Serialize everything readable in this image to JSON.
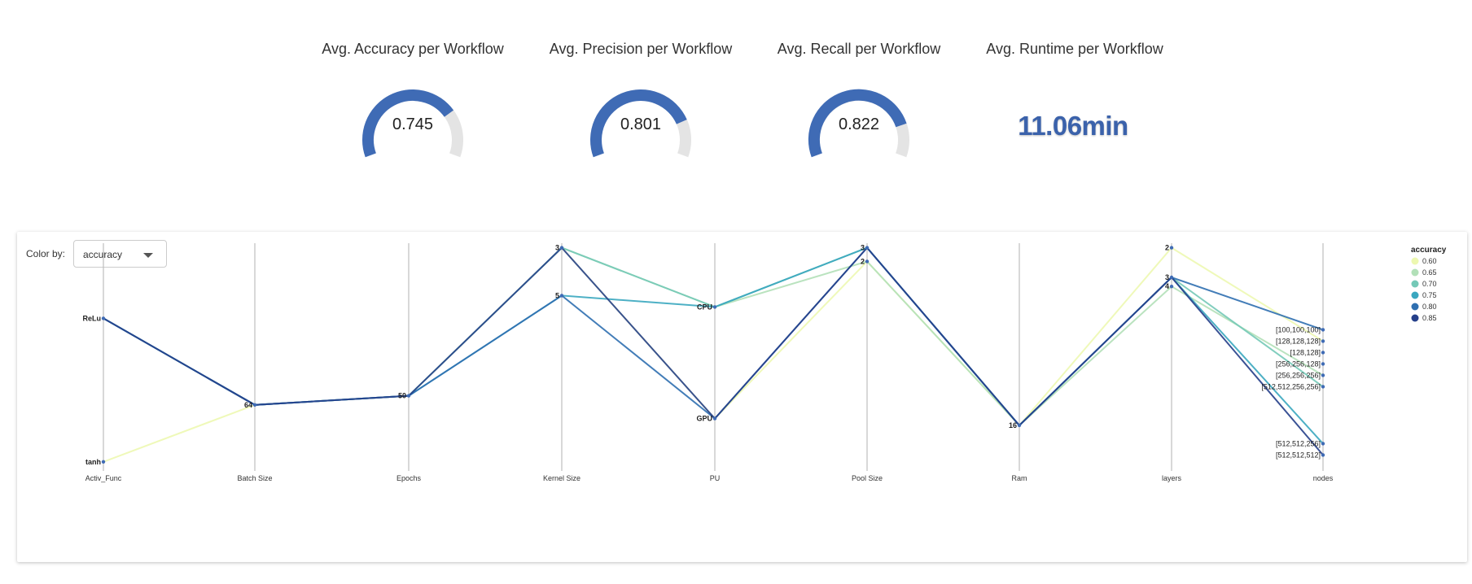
{
  "kpis": {
    "accuracy": {
      "title": "Avg. Accuracy per Workflow",
      "value": "0.745",
      "fraction": 0.745
    },
    "precision": {
      "title": "Avg. Precision per Workflow",
      "value": "0.801",
      "fraction": 0.801
    },
    "recall": {
      "title": "Avg. Recall per Workflow",
      "value": "0.822",
      "fraction": 0.822
    },
    "runtime": {
      "title": "Avg. Runtime per Workflow",
      "value": "11.06min"
    }
  },
  "colors": {
    "gauge_fill": "#3f6bb5",
    "gauge_track": "#e4e4e4",
    "runtime_text": "#3b62ab",
    "axis": "#bdbdbd"
  },
  "controls": {
    "color_by_label": "Color by:",
    "color_by_value": "accuracy"
  },
  "chart_data": {
    "type": "parallel_coordinates",
    "axes": [
      {
        "name": "Activ_Func",
        "ticks": [
          "ReLu",
          "tanh"
        ]
      },
      {
        "name": "Batch Size",
        "ticks": [
          "64"
        ]
      },
      {
        "name": "Epochs",
        "ticks": [
          "50"
        ]
      },
      {
        "name": "Kernel Size",
        "ticks": [
          "3",
          "5"
        ]
      },
      {
        "name": "PU",
        "ticks": [
          "CPU",
          "GPU"
        ]
      },
      {
        "name": "Pool Size",
        "ticks": [
          "3",
          "2"
        ]
      },
      {
        "name": "Ram",
        "ticks": [
          "16"
        ]
      },
      {
        "name": "layers",
        "ticks": [
          "2",
          "3",
          "4"
        ]
      },
      {
        "name": "nodes",
        "ticks": [
          "[100,100,100]",
          "[128,128,128]",
          "[128,128]",
          "[256,256,128]",
          "[256,256,256]",
          "[512,512,256,256]",
          "[512,512,256]",
          "[512,512,512]"
        ]
      }
    ],
    "legend": {
      "title": "accuracy",
      "entries": [
        {
          "label": "0.60",
          "color": "#edf8b1"
        },
        {
          "label": "0.65",
          "color": "#b2e0b8"
        },
        {
          "label": "0.70",
          "color": "#74c9b7"
        },
        {
          "label": "0.75",
          "color": "#3aa7bf"
        },
        {
          "label": "0.80",
          "color": "#2f6fb0"
        },
        {
          "label": "0.85",
          "color": "#253f8a"
        }
      ]
    },
    "records": [
      {
        "Activ_Func": "tanh",
        "Batch Size": "64",
        "Epochs": "50",
        "Kernel Size": "3",
        "PU": "GPU",
        "Pool Size": "2",
        "Ram": "16",
        "layers": "2",
        "nodes": "[128,128,128]",
        "accuracy": 0.6
      },
      {
        "Activ_Func": "ReLu",
        "Batch Size": "64",
        "Epochs": "50",
        "Kernel Size": "3",
        "PU": "CPU",
        "Pool Size": "2",
        "Ram": "16",
        "layers": "4",
        "nodes": "[256,256,256]",
        "accuracy": 0.65
      },
      {
        "Activ_Func": "ReLu",
        "Batch Size": "64",
        "Epochs": "50",
        "Kernel Size": "3",
        "PU": "CPU",
        "Pool Size": "3",
        "Ram": "16",
        "layers": "3",
        "nodes": "[512,512,256,256]",
        "accuracy": 0.7
      },
      {
        "Activ_Func": "ReLu",
        "Batch Size": "64",
        "Epochs": "50",
        "Kernel Size": "5",
        "PU": "CPU",
        "Pool Size": "3",
        "Ram": "16",
        "layers": "3",
        "nodes": "[512,512,256]",
        "accuracy": 0.75
      },
      {
        "Activ_Func": "ReLu",
        "Batch Size": "64",
        "Epochs": "50",
        "Kernel Size": "5",
        "PU": "GPU",
        "Pool Size": "3",
        "Ram": "16",
        "layers": "3",
        "nodes": "[100,100,100]",
        "accuracy": 0.8
      },
      {
        "Activ_Func": "ReLu",
        "Batch Size": "64",
        "Epochs": "50",
        "Kernel Size": "3",
        "PU": "GPU",
        "Pool Size": "3",
        "Ram": "16",
        "layers": "3",
        "nodes": "[512,512,512]",
        "accuracy": 0.85
      }
    ]
  }
}
